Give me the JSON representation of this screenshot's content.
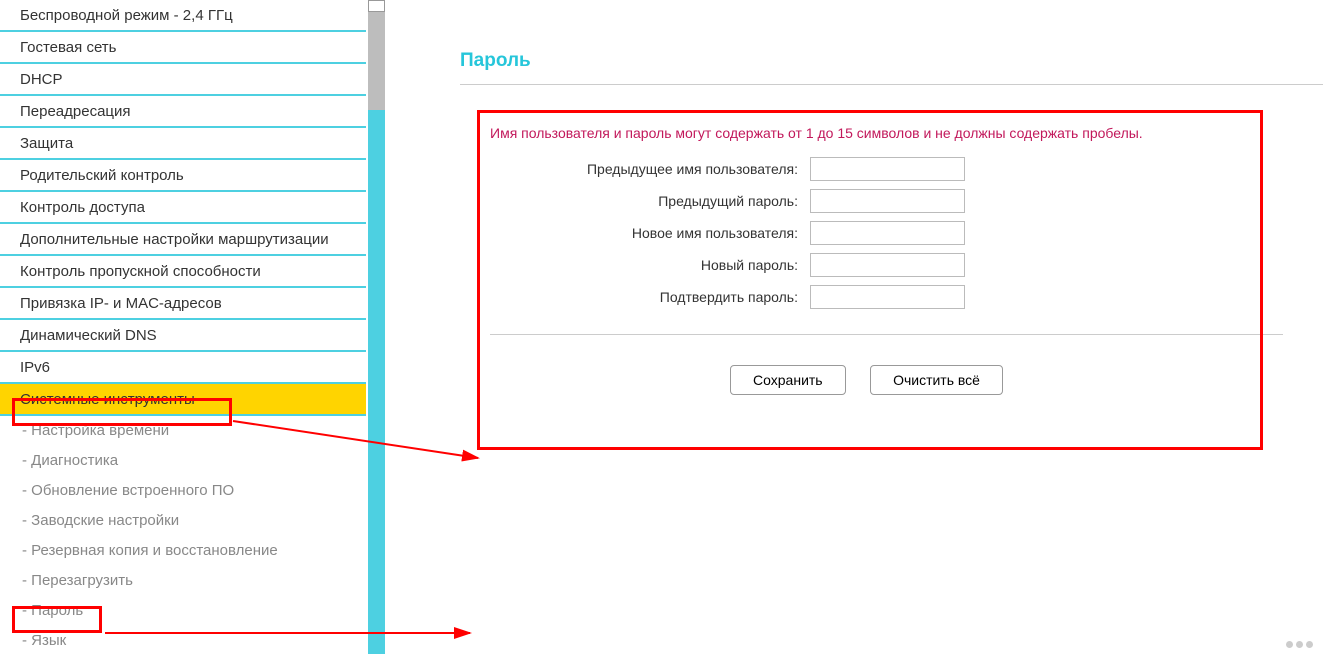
{
  "sidebar": {
    "items": [
      {
        "label": "Беспроводной режим - 2,4 ГГц",
        "sub": false,
        "active": false
      },
      {
        "label": "Гостевая сеть",
        "sub": false,
        "active": false
      },
      {
        "label": "DHCP",
        "sub": false,
        "active": false
      },
      {
        "label": "Переадресация",
        "sub": false,
        "active": false
      },
      {
        "label": "Защита",
        "sub": false,
        "active": false
      },
      {
        "label": "Родительский контроль",
        "sub": false,
        "active": false
      },
      {
        "label": "Контроль доступа",
        "sub": false,
        "active": false
      },
      {
        "label": "Дополнительные настройки маршрутизации",
        "sub": false,
        "active": false
      },
      {
        "label": "Контроль пропускной способности",
        "sub": false,
        "active": false
      },
      {
        "label": "Привязка IP- и MAC-адресов",
        "sub": false,
        "active": false
      },
      {
        "label": "Динамический DNS",
        "sub": false,
        "active": false
      },
      {
        "label": "IPv6",
        "sub": false,
        "active": false
      },
      {
        "label": "Системные инструменты",
        "sub": false,
        "active": true
      },
      {
        "label": "- Настройка времени",
        "sub": true,
        "active": false
      },
      {
        "label": "- Диагностика",
        "sub": true,
        "active": false
      },
      {
        "label": "- Обновление встроенного ПО",
        "sub": true,
        "active": false
      },
      {
        "label": "- Заводские настройки",
        "sub": true,
        "active": false
      },
      {
        "label": "- Резервная копия и восстановление",
        "sub": true,
        "active": false
      },
      {
        "label": "- Перезагрузить",
        "sub": true,
        "active": false
      },
      {
        "label": "- Пароль",
        "sub": true,
        "active": false
      },
      {
        "label": "- Язык",
        "sub": true,
        "active": false
      }
    ]
  },
  "page": {
    "title": "Пароль",
    "warning": "Имя пользователя и пароль могут содержать от 1 до 15 символов и не должны содержать пробелы.",
    "fields": {
      "prev_user": "Предыдущее имя пользователя:",
      "prev_pass": "Предыдущий пароль:",
      "new_user": "Новое имя пользователя:",
      "new_pass": "Новый пароль:",
      "confirm": "Подтвердить пароль:"
    },
    "buttons": {
      "save": "Сохранить",
      "clear": "Очистить всё"
    }
  }
}
